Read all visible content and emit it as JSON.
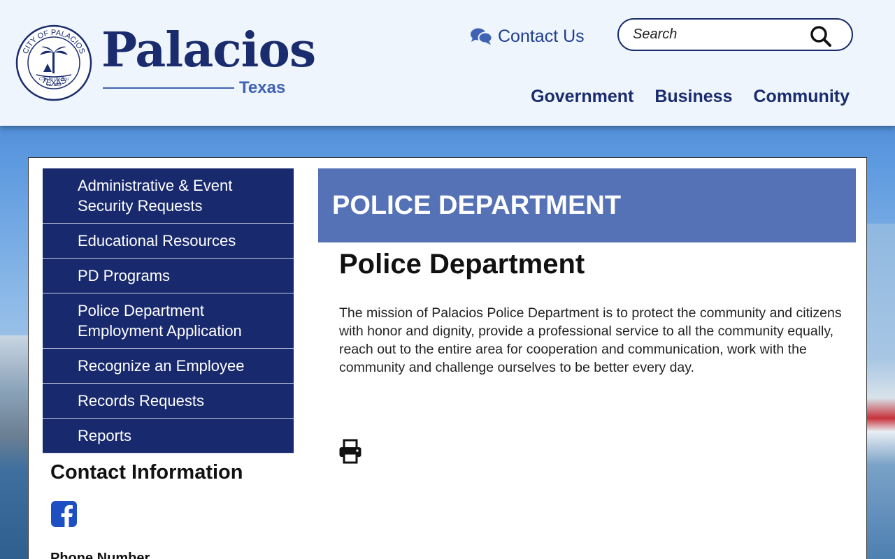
{
  "logo": {
    "seal_top_text": "CITY OF PALACIOS",
    "seal_bottom_text": "TEXAS",
    "seal_motto": "City by the Sea",
    "seal_est": "est. 1909",
    "name": "Palacios",
    "subtitle": "Texas"
  },
  "header": {
    "contact_label": "Contact Us",
    "search_placeholder": "Search",
    "nav": [
      "Government",
      "Business",
      "Community"
    ]
  },
  "sidebar": {
    "items": [
      "Administrative & Event Security Requests",
      "Educational Resources",
      "PD Programs",
      "Police Department Employment Application",
      "Recognize an Employee",
      "Records Requests",
      "Reports"
    ],
    "contact_title": "Contact Information",
    "phone_label": "Phone Number"
  },
  "main": {
    "banner": "POLICE DEPARTMENT",
    "title": "Police Department",
    "mission": "The mission of Palacios Police Department is to protect the community and citizens with honor and dignity, provide a professional service to all the community equally, reach out to the entire area for cooperation and communication, work with the community and challenge ourselves to be better every day."
  },
  "colors": {
    "navy": "#18296e",
    "banner_blue": "#5672b7",
    "header_bg": "#eef5fc",
    "link_blue": "#1f3f8f"
  },
  "icons": {
    "contact": "chat-bubbles-icon",
    "search": "magnifier-icon",
    "social": "facebook-icon",
    "print": "printer-icon"
  }
}
